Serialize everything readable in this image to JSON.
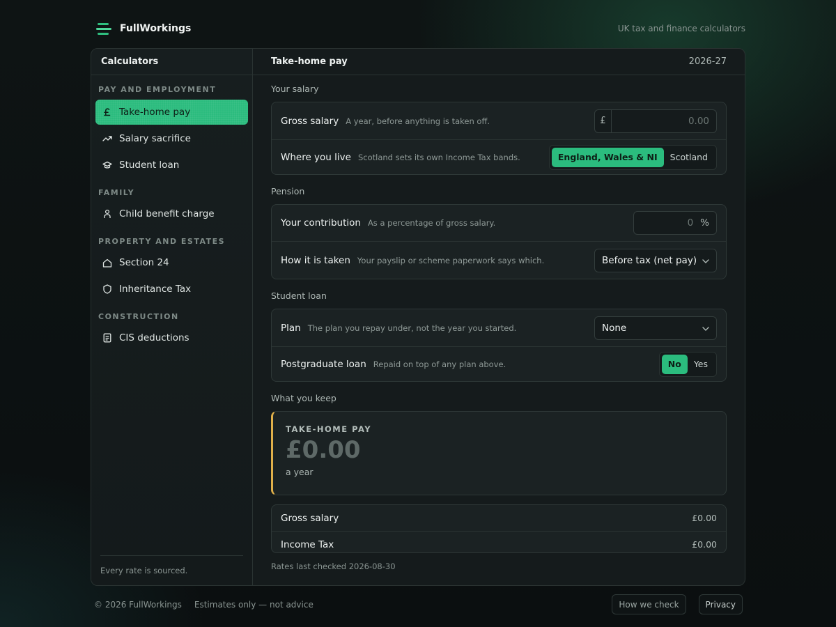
{
  "brand": {
    "name": "FullWorkings",
    "tagline": "UK tax and finance calculators"
  },
  "sidebar": {
    "title": "Calculators",
    "groups": [
      {
        "label": "PAY AND EMPLOYMENT",
        "items": [
          {
            "label": "Take-home pay",
            "icon": "pound-icon",
            "active": true
          },
          {
            "label": "Salary sacrifice",
            "icon": "trend-up-icon"
          },
          {
            "label": "Student loan",
            "icon": "graduation-cap-icon"
          }
        ]
      },
      {
        "label": "FAMILY",
        "items": [
          {
            "label": "Child benefit charge",
            "icon": "person-icon"
          }
        ]
      },
      {
        "label": "PROPERTY AND ESTATES",
        "items": [
          {
            "label": "Section 24",
            "icon": "house-icon"
          },
          {
            "label": "Inheritance Tax",
            "icon": "shield-icon"
          }
        ]
      },
      {
        "label": "CONSTRUCTION",
        "items": [
          {
            "label": "CIS deductions",
            "icon": "document-icon"
          }
        ]
      }
    ],
    "footer": "Every rate is sourced."
  },
  "main": {
    "title": "Take-home pay",
    "year": "2026-27",
    "salary": {
      "label": "Your salary",
      "gross": {
        "label": "Gross salary",
        "hint": "A year, before anything is taken off.",
        "prefix": "£",
        "placeholder": "0.00"
      },
      "where": {
        "label": "Where you live",
        "hint": "Scotland sets its own Income Tax bands.",
        "options": [
          "England, Wales & NI",
          "Scotland"
        ],
        "selected": "England, Wales & NI"
      }
    },
    "pension": {
      "label": "Pension",
      "contribution": {
        "label": "Your contribution",
        "hint": "As a percentage of gross salary.",
        "placeholder": "0",
        "suffix": "%"
      },
      "taken": {
        "label": "How it is taken",
        "hint": "Your payslip or scheme paperwork says which.",
        "value": "Before tax (net pay)"
      }
    },
    "student_loan": {
      "label": "Student loan",
      "plan": {
        "label": "Plan",
        "hint": "The plan you repay under, not the year you started.",
        "value": "None"
      },
      "postgrad": {
        "label": "Postgraduate loan",
        "hint": "Repaid on top of any plan above.",
        "options": [
          "No",
          "Yes"
        ],
        "selected": "No"
      }
    },
    "result": {
      "section_label": "What you keep",
      "key": "TAKE-HOME PAY",
      "amount": "£0.00",
      "unit": "a year"
    },
    "breakdown": [
      {
        "label": "Gross salary",
        "value": "£0.00"
      },
      {
        "label": "Income Tax",
        "value": "£0.00"
      }
    ],
    "rates_checked": "Rates last checked 2026-08-30"
  },
  "footer": {
    "copyright": "© 2026 FullWorkings",
    "disclaimer": "Estimates only — not advice",
    "links": [
      "How we check",
      "Privacy"
    ]
  },
  "colors": {
    "accent": "#2bbc7e",
    "result_border": "#e0b04a"
  }
}
